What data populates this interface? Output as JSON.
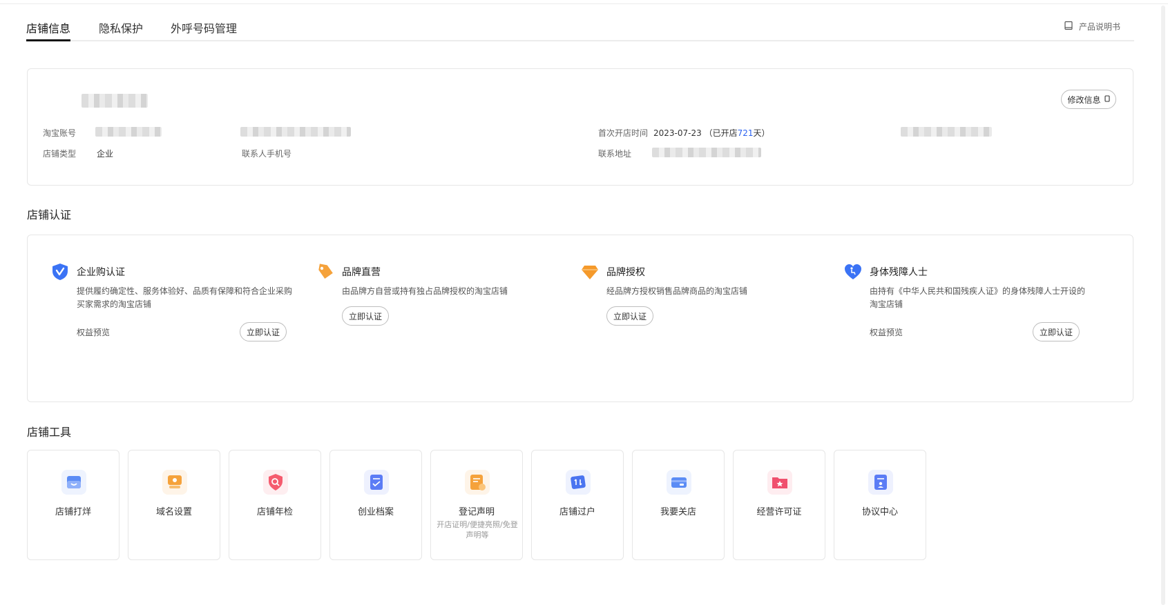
{
  "tabs": [
    {
      "label": "店铺信息",
      "active": true
    },
    {
      "label": "隐私保护",
      "active": false
    },
    {
      "label": "外呼号码管理",
      "active": false
    }
  ],
  "manual_label": "产品说明书",
  "store_info": {
    "edit_label": "修改信息",
    "taobao_account_label": "淘宝账号",
    "store_type_label": "店铺类型",
    "store_type_value": "企业",
    "contact_phone_label": "联系人手机号",
    "open_time_label": "首次开店时间",
    "open_date": "2023-07-23",
    "open_days_prefix": "（已开店",
    "open_days": "721",
    "open_days_suffix": "天）",
    "address_label": "联系地址"
  },
  "cert_section": {
    "title": "店铺认证",
    "items": [
      {
        "title": "企业购认证",
        "desc": "提供履约确定性、服务体验好、品质有保障和符合企业采购买家需求的淘宝店铺",
        "benefit": "权益预览",
        "button": "立即认证",
        "icon": "shield-check-icon",
        "color": "#3b73f5"
      },
      {
        "title": "品牌直营",
        "desc": "由品牌方自营或持有独占品牌授权的淘宝店铺",
        "benefit": "",
        "button": "立即认证",
        "icon": "tag-icon",
        "color": "#f5a23b"
      },
      {
        "title": "品牌授权",
        "desc": "经品牌方授权销售品牌商品的淘宝店铺",
        "benefit": "",
        "button": "立即认证",
        "icon": "diamond-icon",
        "color": "#f59a2b"
      },
      {
        "title": "身体残障人士",
        "desc": "由持有《中华人民共和国残疾人证》的身体残障人士开设的淘宝店铺",
        "benefit": "权益预览",
        "button": "立即认证",
        "icon": "heart-accessibility-icon",
        "color": "#3b73f5"
      }
    ]
  },
  "tools_section": {
    "title": "店铺工具",
    "items": [
      {
        "name": "店铺打烊",
        "desc": "",
        "icon": "store-close-icon",
        "color": "#5b8cf5"
      },
      {
        "name": "域名设置",
        "desc": "",
        "icon": "domain-icon",
        "color": "#f5a23b"
      },
      {
        "name": "店铺年检",
        "desc": "",
        "icon": "shield-search-icon",
        "color": "#f55b6e"
      },
      {
        "name": "创业档案",
        "desc": "",
        "icon": "archive-icon",
        "color": "#5b7cf5"
      },
      {
        "name": "登记声明",
        "desc": "开店证明/便捷亮照/免登声明等",
        "icon": "registration-icon",
        "color": "#f5a23b"
      },
      {
        "name": "店铺过户",
        "desc": "",
        "icon": "transfer-icon",
        "color": "#4a74f0"
      },
      {
        "name": "我要关店",
        "desc": "",
        "icon": "close-store-icon",
        "color": "#5b8cf5"
      },
      {
        "name": "经营许可证",
        "desc": "",
        "icon": "license-folder-icon",
        "color": "#f0506e"
      },
      {
        "name": "协议中心",
        "desc": "",
        "icon": "agreement-icon",
        "color": "#5b7cf5"
      }
    ]
  }
}
